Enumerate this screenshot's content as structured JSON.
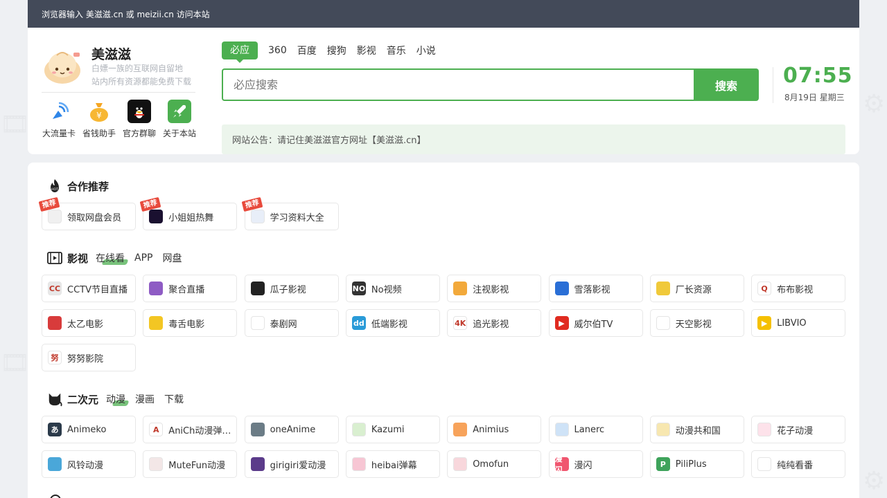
{
  "topbar": {
    "text": "浏览器输入 美滋滋.cn 或 meizii.cn 访问本站"
  },
  "site": {
    "title": "美滋滋",
    "subtitle_line1": "白嫖一族的互联网自留地",
    "subtitle_line2": "站内所有资源都能免费下载"
  },
  "quick_links": [
    {
      "label": "大流量卡",
      "icon": "signal-icon",
      "color": "#2f86e8"
    },
    {
      "label": "省钱助手",
      "icon": "money-bag-icon",
      "color": "#f5a623"
    },
    {
      "label": "官方群聊",
      "icon": "qq-penguin-icon",
      "color": "#111111"
    },
    {
      "label": "关于本站",
      "icon": "rocket-icon",
      "color": "#4caf50"
    }
  ],
  "search": {
    "engines": [
      "必应",
      "360",
      "百度",
      "搜狗",
      "影视",
      "音乐",
      "小说"
    ],
    "active_engine": "必应",
    "placeholder": "必应搜索",
    "button_label": "搜索"
  },
  "clock": {
    "time": "07:55",
    "date": "8月19日 星期三"
  },
  "notice": {
    "text": "网站公告：请记住美滋滋官方网址【美滋滋.cn】"
  },
  "sections": {
    "partner": {
      "title": "合作推荐",
      "icon": "hot-flame-icon",
      "items": [
        {
          "label": "领取网盘会员",
          "badge": "推荐",
          "icon_color": "#f0f0f0",
          "icon_text": ""
        },
        {
          "label": "小姐姐热舞",
          "badge": "推荐",
          "icon_color": "#1a1030",
          "icon_text": ""
        },
        {
          "label": "学习资料大全",
          "badge": "推荐",
          "icon_color": "#e8eef8",
          "icon_text": ""
        }
      ]
    },
    "video": {
      "title": "影视",
      "icon": "film-icon",
      "tabs": [
        "在线看",
        "APP",
        "网盘"
      ],
      "active_tab": "在线看",
      "items": [
        {
          "label": "CCTV节目直播",
          "icon_color": "#e8e8e8",
          "icon_text": "CC"
        },
        {
          "label": "聚合直播",
          "icon_color": "#8e5bc4",
          "icon_text": ""
        },
        {
          "label": "瓜子影视",
          "icon_color": "#222222",
          "icon_text": ""
        },
        {
          "label": "No视频",
          "icon_color": "#333333",
          "icon_text": "NO"
        },
        {
          "label": "注视影视",
          "icon_color": "#f2a93b",
          "icon_text": ""
        },
        {
          "label": "雪落影视",
          "icon_color": "#2a6fd6",
          "icon_text": ""
        },
        {
          "label": "厂长资源",
          "icon_color": "#f0c93a",
          "icon_text": ""
        },
        {
          "label": "布布影视",
          "icon_color": "#ffffff",
          "icon_text": "Q"
        },
        {
          "label": "太乙电影",
          "icon_color": "#d83b3b",
          "icon_text": ""
        },
        {
          "label": "毒舌电影",
          "icon_color": "#f3c623",
          "icon_text": ""
        },
        {
          "label": "泰剧网",
          "icon_color": "#ffffff",
          "icon_text": ""
        },
        {
          "label": "低端影视",
          "icon_color": "#2a9bd8",
          "icon_text": "dd"
        },
        {
          "label": "追光影视",
          "icon_color": "#ffffff",
          "icon_text": "4K"
        },
        {
          "label": "威尔伯TV",
          "icon_color": "#e02b20",
          "icon_text": "▶"
        },
        {
          "label": "天空影视",
          "icon_color": "#ffffff",
          "icon_text": ""
        },
        {
          "label": "LIBVIO",
          "icon_color": "#f5c000",
          "icon_text": "▶"
        },
        {
          "label": "努努影院",
          "icon_color": "#ffffff",
          "icon_text": "努"
        }
      ]
    },
    "anime": {
      "title": "二次元",
      "icon": "cat-icon",
      "tabs": [
        "动漫",
        "漫画",
        "下载"
      ],
      "active_tab": "动漫",
      "items": [
        {
          "label": "Animeko",
          "icon_color": "#2b3a4a",
          "icon_text": "あ"
        },
        {
          "label": "AniCh动漫弹幕播放",
          "icon_color": "#ffffff",
          "icon_text": "A"
        },
        {
          "label": "oneAnime",
          "icon_color": "#6b7c86",
          "icon_text": ""
        },
        {
          "label": "Kazumi",
          "icon_color": "#d9efd0",
          "icon_text": ""
        },
        {
          "label": "Animius",
          "icon_color": "#f7a35b",
          "icon_text": ""
        },
        {
          "label": "Lanerc",
          "icon_color": "#cfe3f7",
          "icon_text": ""
        },
        {
          "label": "动漫共和国",
          "icon_color": "#f7e7b0",
          "icon_text": ""
        },
        {
          "label": "花子动漫",
          "icon_color": "#fde2ea",
          "icon_text": ""
        },
        {
          "label": "风铃动漫",
          "icon_color": "#4aa7d9",
          "icon_text": ""
        },
        {
          "label": "MuteFun动漫",
          "icon_color": "#f3e7e7",
          "icon_text": ""
        },
        {
          "label": "girigiri爱动漫",
          "icon_color": "#5b3b8a",
          "icon_text": ""
        },
        {
          "label": "heibai弹幕",
          "icon_color": "#f7c6d4",
          "icon_text": ""
        },
        {
          "label": "Omofun",
          "icon_color": "#f8d7dc",
          "icon_text": ""
        },
        {
          "label": "漫闪",
          "icon_color": "#f0566f",
          "icon_text": "漫闪"
        },
        {
          "label": "PiliPlus",
          "icon_color": "#3ea35b",
          "icon_text": "P"
        },
        {
          "label": "纯纯看番",
          "icon_color": "#ffffff",
          "icon_text": ""
        }
      ]
    }
  },
  "colors": {
    "accent": "#4caf50",
    "topbar": "#434a59",
    "badge": "#e84a3c"
  }
}
